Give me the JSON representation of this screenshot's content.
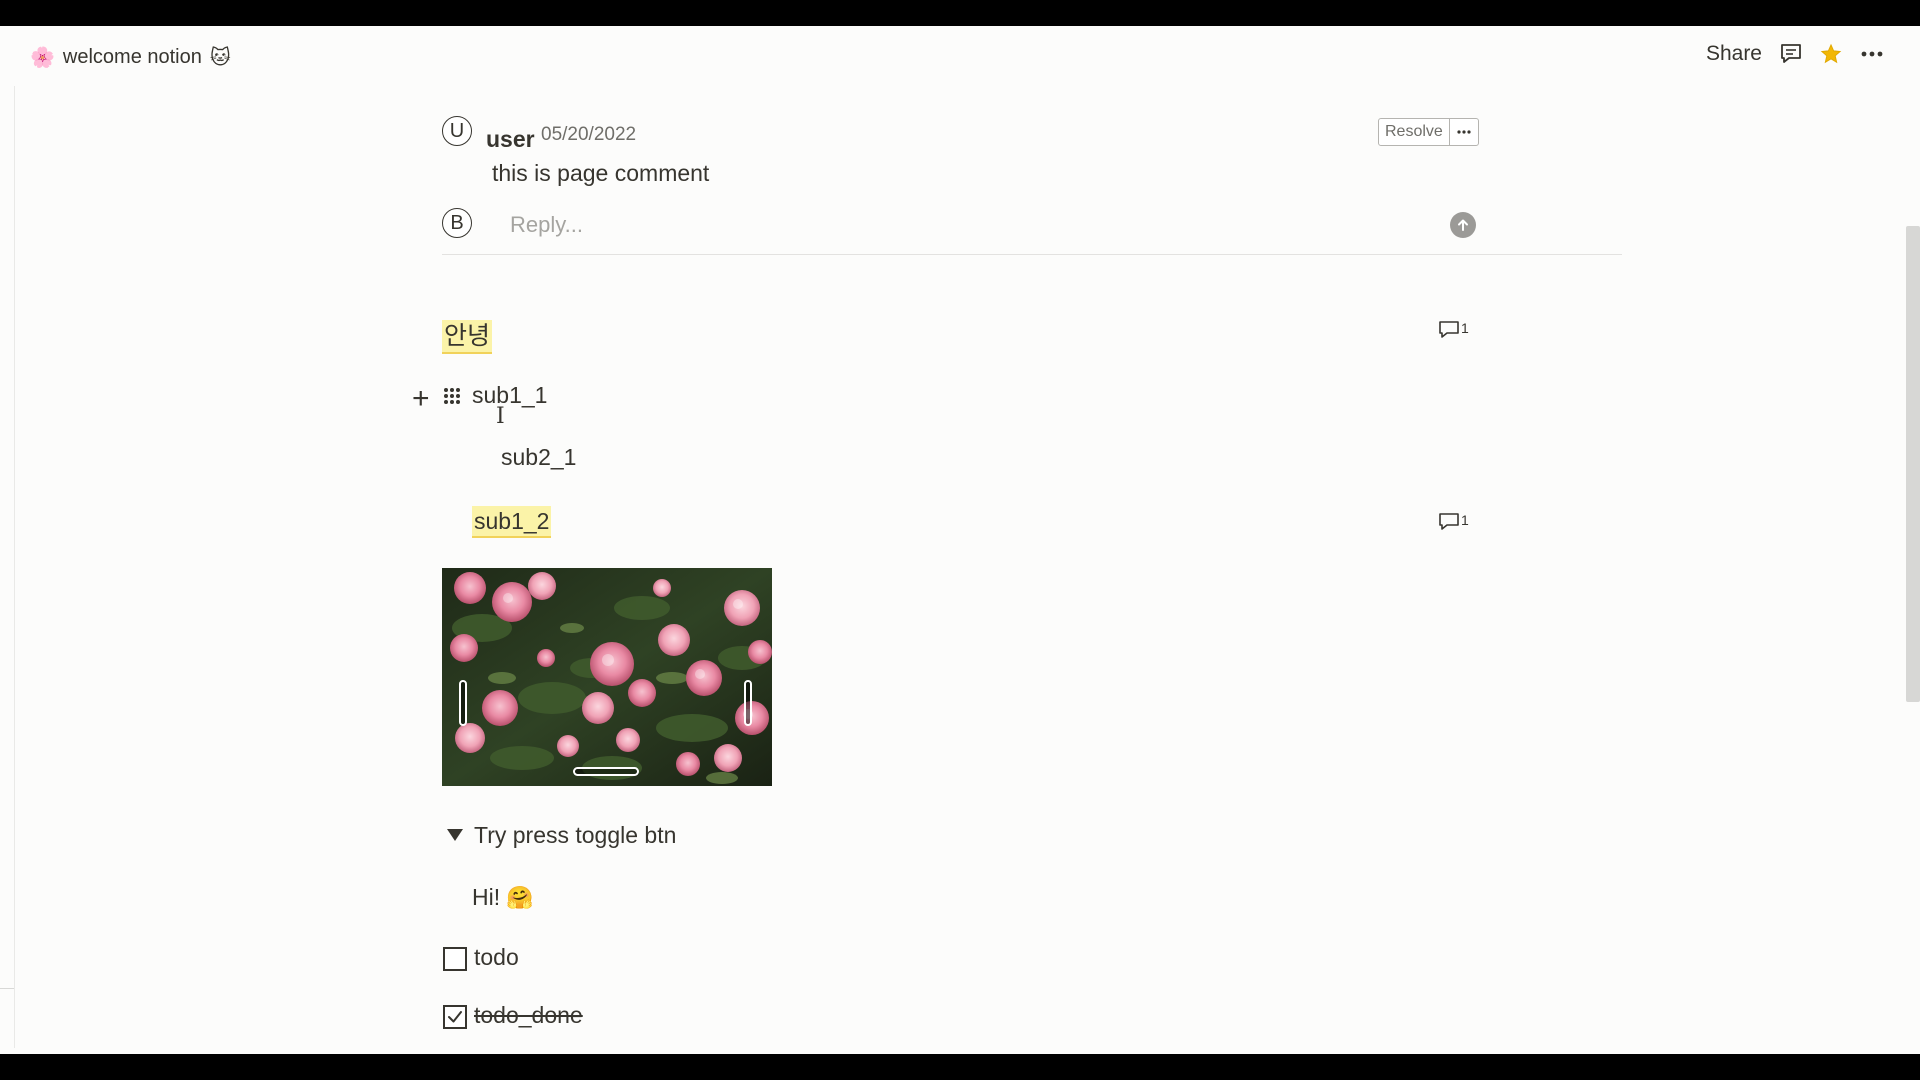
{
  "topbar": {
    "page_icon": "🌸",
    "page_title": "welcome notion",
    "title_emoji": "🐱",
    "share_label": "Share",
    "icons": [
      "comment-icon",
      "star-icon",
      "more-icon"
    ],
    "star_color": "#f2b705"
  },
  "comment": {
    "author_initial": "U",
    "author": "user",
    "date": "05/20/2022",
    "text": "this is page comment",
    "resolve_label": "Resolve",
    "reply_initial": "B",
    "reply_placeholder": "Reply..."
  },
  "blocks": {
    "heading": "안녕",
    "heading_comment_count": "1",
    "sub1_1": "sub1_1",
    "sub2_1": "sub2_1",
    "sub1_2": "sub1_2",
    "sub1_2_comment_count": "1",
    "image_alt": "pink roses",
    "toggle_label": "Try press toggle btn",
    "toggle_child": "Hi!",
    "toggle_child_emoji": "🤗",
    "todo_label": "todo",
    "todo_done_label": "todo_done"
  },
  "colors": {
    "highlight": "#fbf3a8",
    "text": "#37352f",
    "muted": "#6f6e69"
  }
}
